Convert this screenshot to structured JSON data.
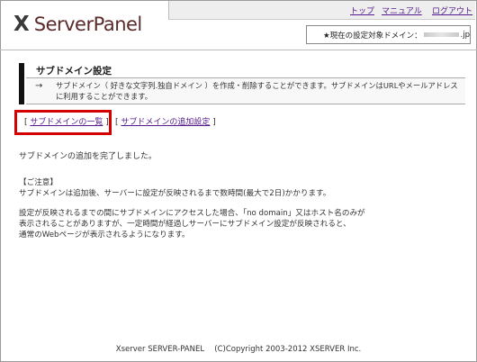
{
  "header": {
    "logo_mark": "X",
    "logo_text": "ServerPanel",
    "nav": {
      "top": "トップ",
      "manual": "マニュアル",
      "logout": "ログアウト"
    },
    "domain_label": "★現在の設定対象ドメイン：",
    "domain_suffix": ".jp"
  },
  "page": {
    "title": "サブドメイン設定",
    "arrow": "→",
    "description": "サブドメイン（ 好きな文字列.独自ドメイン ）を作成・削除することができます。サブドメインはURLやメールアドレスに利用することができます。"
  },
  "links": {
    "list": "サブドメインの一覧",
    "add": "サブドメインの追加設定",
    "open": "[",
    "close": "]"
  },
  "message": "サブドメインの追加を完了しました。",
  "notes": {
    "heading": "【ご注意】",
    "line1": "サブドメインは追加後、サーバーに設定が反映されるまで数時間(最大で2日)かかります。",
    "line2": "設定が反映されるまでの間にサブドメインにアクセスした場合、「no domain」又はホスト名のみが",
    "line3": "表示されることがありますが、一定時間が経過しサーバーにサブドメイン設定が反映されると、",
    "line4": "通常のWebページが表示されるようになります。"
  },
  "footer": "Xserver SERVER-PANEL　 (C)Copyright 2003-2012 XSERVER Inc."
}
